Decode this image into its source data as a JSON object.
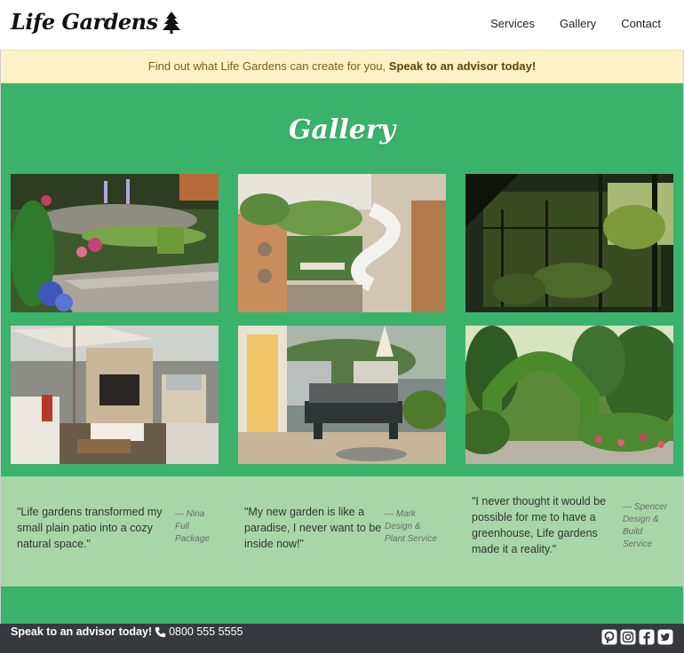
{
  "header": {
    "logo_text": "Life Gardens",
    "logo_icon": "tree-icon",
    "nav": [
      {
        "label": "Services"
      },
      {
        "label": "Gallery"
      },
      {
        "label": "Contact"
      }
    ]
  },
  "banner": {
    "text": "Find out what Life Gardens can create for you,",
    "cta": "Speak to an advisor today!"
  },
  "gallery": {
    "title": "Gallery",
    "images": [
      {
        "subject": "garden with stone wall and flowers"
      },
      {
        "subject": "aerial rooftop garden with spiral stairs"
      },
      {
        "subject": "greenhouse interior"
      },
      {
        "subject": "patio with outdoor fireplace"
      },
      {
        "subject": "deck with outdoor seating"
      },
      {
        "subject": "garden archway with plants"
      }
    ]
  },
  "testimonials": [
    {
      "quote": "\"Life gardens transformed my small plain patio into a cozy natural space.\"",
      "author_line1": "— Nina",
      "author_line2": "Full",
      "author_line3": "Package"
    },
    {
      "quote": "\"My new garden is like a paradise, I never want to be inside now!\"",
      "author_line1": "— Mark",
      "author_line2": "Design &",
      "author_line3": "Plant Service"
    },
    {
      "quote": "\"I never thought it would be possible for me to have a greenhouse, Life gardens made it a reality.\"",
      "author_line1": "— Spencer",
      "author_line2": "Design &",
      "author_line3": "Build",
      "author_line4": "Service"
    }
  ],
  "footer": {
    "cta": "Speak to an advisor today!",
    "phone": "0800 555 5555",
    "socials": [
      "pinterest-icon",
      "instagram-icon",
      "facebook-icon",
      "twitter-icon"
    ]
  },
  "colors": {
    "brand_green": "#3bb26b",
    "testimonial_bg": "#a8d6a8",
    "banner_bg": "#fdf1c8",
    "footer_bg": "#36393f"
  }
}
